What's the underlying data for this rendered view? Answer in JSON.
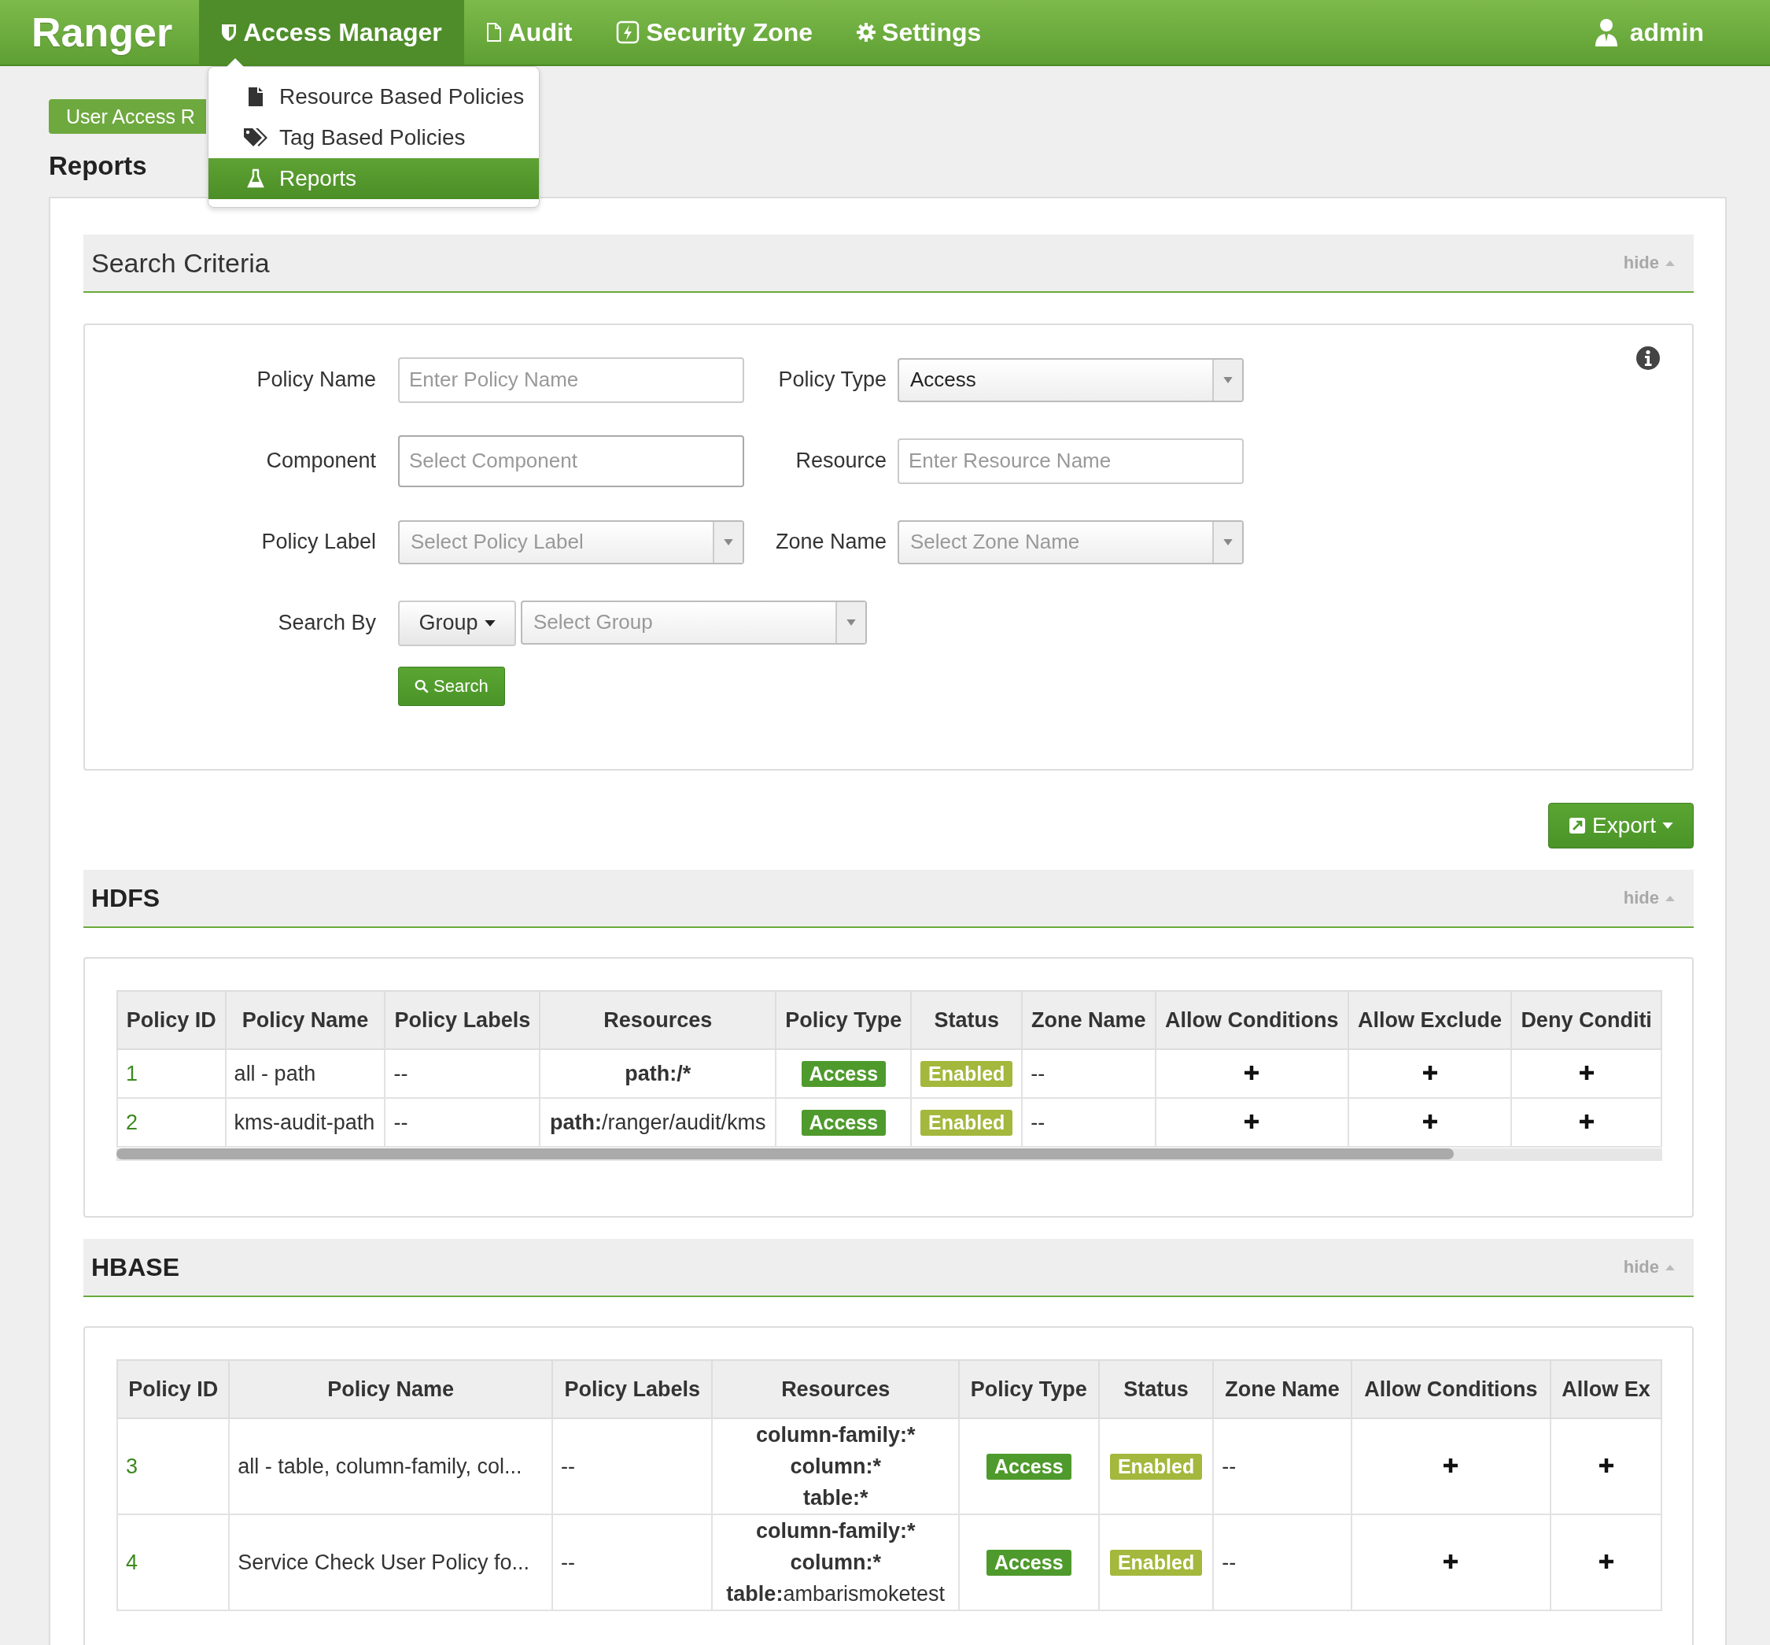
{
  "navbar": {
    "brand": "Ranger",
    "items": [
      {
        "label": "Access Manager",
        "selected": true
      },
      {
        "label": "Audit",
        "selected": false
      },
      {
        "label": "Security Zone",
        "selected": false
      },
      {
        "label": "Settings",
        "selected": false
      }
    ],
    "user": "admin"
  },
  "dropdown": {
    "items": [
      {
        "label": "Resource Based Policies",
        "selected": false
      },
      {
        "label": "Tag Based Policies",
        "selected": false
      },
      {
        "label": "Reports",
        "selected": true
      }
    ]
  },
  "report_button": "User Access R",
  "page_title": "Reports",
  "search_criteria": {
    "title": "Search Criteria",
    "hide": "hide",
    "fields": [
      {
        "label": "Policy Name",
        "kind": "input",
        "placeholder": "Enter Policy Name"
      },
      {
        "label": "Policy Type",
        "kind": "select",
        "value": "Access"
      },
      {
        "label": "Component",
        "kind": "input",
        "placeholder": "Select Component"
      },
      {
        "label": "Resource",
        "kind": "input",
        "placeholder": "Enter Resource Name"
      },
      {
        "label": "Policy Label",
        "kind": "select",
        "placeholder": "Select Policy Label"
      },
      {
        "label": "Zone Name",
        "kind": "select",
        "placeholder": "Select Zone Name"
      },
      {
        "label": "Search By",
        "kind": "combo",
        "button": "Group",
        "placeholder": "Select Group"
      }
    ],
    "search_button": "Search"
  },
  "export_button": "Export",
  "sections": [
    {
      "title": "HDFS",
      "hide": "hide",
      "columns": [
        "Policy ID",
        "Policy Name",
        "Policy Labels",
        "Resources",
        "Policy Type",
        "Status",
        "Zone Name",
        "Allow Conditions",
        "Allow Exclude",
        "Deny Conditi"
      ],
      "rows": [
        {
          "cells": [
            {
              "kind": "link",
              "text": "1"
            },
            {
              "kind": "text",
              "text": "all - path"
            },
            {
              "kind": "text",
              "text": "--"
            },
            {
              "kind": "resources",
              "lines": [
                {
                  "key": "path:",
                  "value": "/*",
                  "value_bold": true
                }
              ]
            },
            {
              "kind": "badge",
              "text": "Access",
              "color": "#4f9a2c"
            },
            {
              "kind": "badge",
              "text": "Enabled",
              "color": "#a3b83c"
            },
            {
              "kind": "text",
              "text": "--"
            },
            {
              "kind": "plus"
            },
            {
              "kind": "plus"
            },
            {
              "kind": "plus"
            }
          ]
        },
        {
          "cells": [
            {
              "kind": "link",
              "text": "2"
            },
            {
              "kind": "text",
              "text": "kms-audit-path"
            },
            {
              "kind": "text",
              "text": "--"
            },
            {
              "kind": "resources",
              "lines": [
                {
                  "key": "path:",
                  "value": "/ranger/audit/kms",
                  "value_bold": false
                }
              ]
            },
            {
              "kind": "badge",
              "text": "Access",
              "color": "#4f9a2c"
            },
            {
              "kind": "badge",
              "text": "Enabled",
              "color": "#a3b83c"
            },
            {
              "kind": "text",
              "text": "--"
            },
            {
              "kind": "plus"
            },
            {
              "kind": "plus"
            },
            {
              "kind": "plus"
            }
          ]
        }
      ],
      "scrollbar": true
    },
    {
      "title": "HBASE",
      "hide": "hide",
      "columns": [
        "Policy ID",
        "Policy Name",
        "Policy Labels",
        "Resources",
        "Policy Type",
        "Status",
        "Zone Name",
        "Allow Conditions",
        "Allow Ex"
      ],
      "rows": [
        {
          "cells": [
            {
              "kind": "link",
              "text": "3"
            },
            {
              "kind": "text",
              "text": "all - table, column-family, col..."
            },
            {
              "kind": "text",
              "text": "--"
            },
            {
              "kind": "resources",
              "lines": [
                {
                  "key": "column-family:",
                  "value": "*",
                  "value_bold": true
                },
                {
                  "key": "column:",
                  "value": "*",
                  "value_bold": true
                },
                {
                  "key": "table:",
                  "value": "*",
                  "value_bold": true
                }
              ]
            },
            {
              "kind": "badge",
              "text": "Access",
              "color": "#4f9a2c"
            },
            {
              "kind": "badge",
              "text": "Enabled",
              "color": "#a3b83c"
            },
            {
              "kind": "text",
              "text": "--"
            },
            {
              "kind": "plus"
            },
            {
              "kind": "plus"
            }
          ]
        },
        {
          "cells": [
            {
              "kind": "link",
              "text": "4"
            },
            {
              "kind": "text",
              "text": "Service Check User Policy fo..."
            },
            {
              "kind": "text",
              "text": "--"
            },
            {
              "kind": "resources",
              "lines": [
                {
                  "key": "column-family:",
                  "value": "*",
                  "value_bold": true
                },
                {
                  "key": "column:",
                  "value": "*",
                  "value_bold": true
                },
                {
                  "key": "table:",
                  "value": "ambarismoketest",
                  "value_bold": false
                }
              ]
            },
            {
              "kind": "badge",
              "text": "Access",
              "color": "#4f9a2c"
            },
            {
              "kind": "badge",
              "text": "Enabled",
              "color": "#a3b83c"
            },
            {
              "kind": "text",
              "text": "--"
            },
            {
              "kind": "plus"
            },
            {
              "kind": "plus"
            }
          ]
        }
      ],
      "scrollbar": false
    }
  ]
}
